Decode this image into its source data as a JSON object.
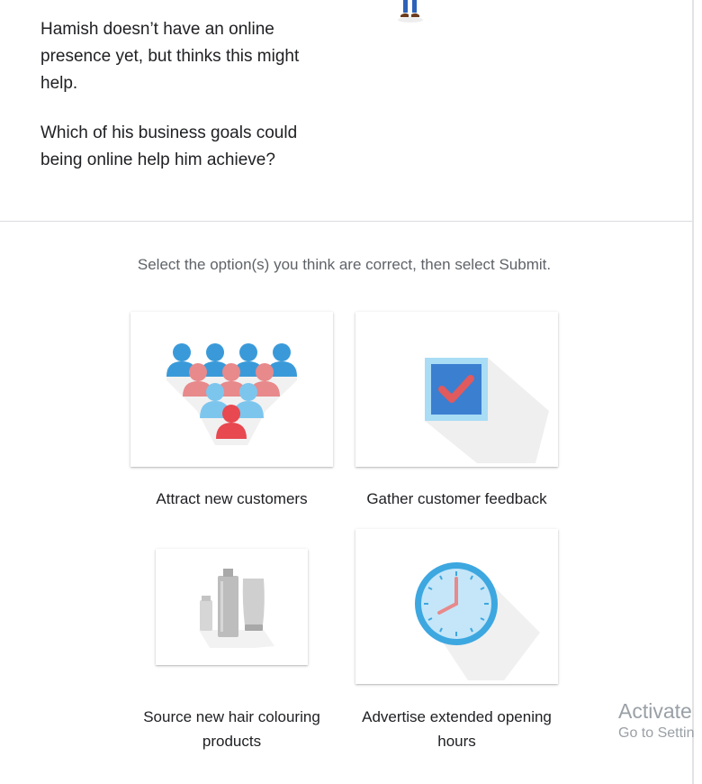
{
  "intro": {
    "paragraph_1": "Hamish doesn’t have an online presence yet, but thinks this might help.",
    "paragraph_2": "Which of his business goals could being online help him achieve?"
  },
  "instruction": "Select the option(s) you think are correct, then select Submit.",
  "options": [
    {
      "label": "Attract new customers",
      "icon": "customers-funnel-icon"
    },
    {
      "label": "Gather customer feedback",
      "icon": "checkbox-icon"
    },
    {
      "label": "Source new hair colouring products",
      "icon": "hair-products-icon"
    },
    {
      "label": "Advertise extended opening hours",
      "icon": "clock-icon"
    }
  ],
  "watermark": {
    "title": "Activate",
    "subtitle": "Go to Settin"
  },
  "colors": {
    "blue_person": "#3a9ad9",
    "pink_person": "#e8898b",
    "light_blue_person": "#7cc6ee",
    "red_person": "#e8484f",
    "checkbox_blue": "#3b7fd0",
    "check_mark": "#e05a5e",
    "clock_ring": "#3da7e0",
    "divider": "#dadce0"
  }
}
